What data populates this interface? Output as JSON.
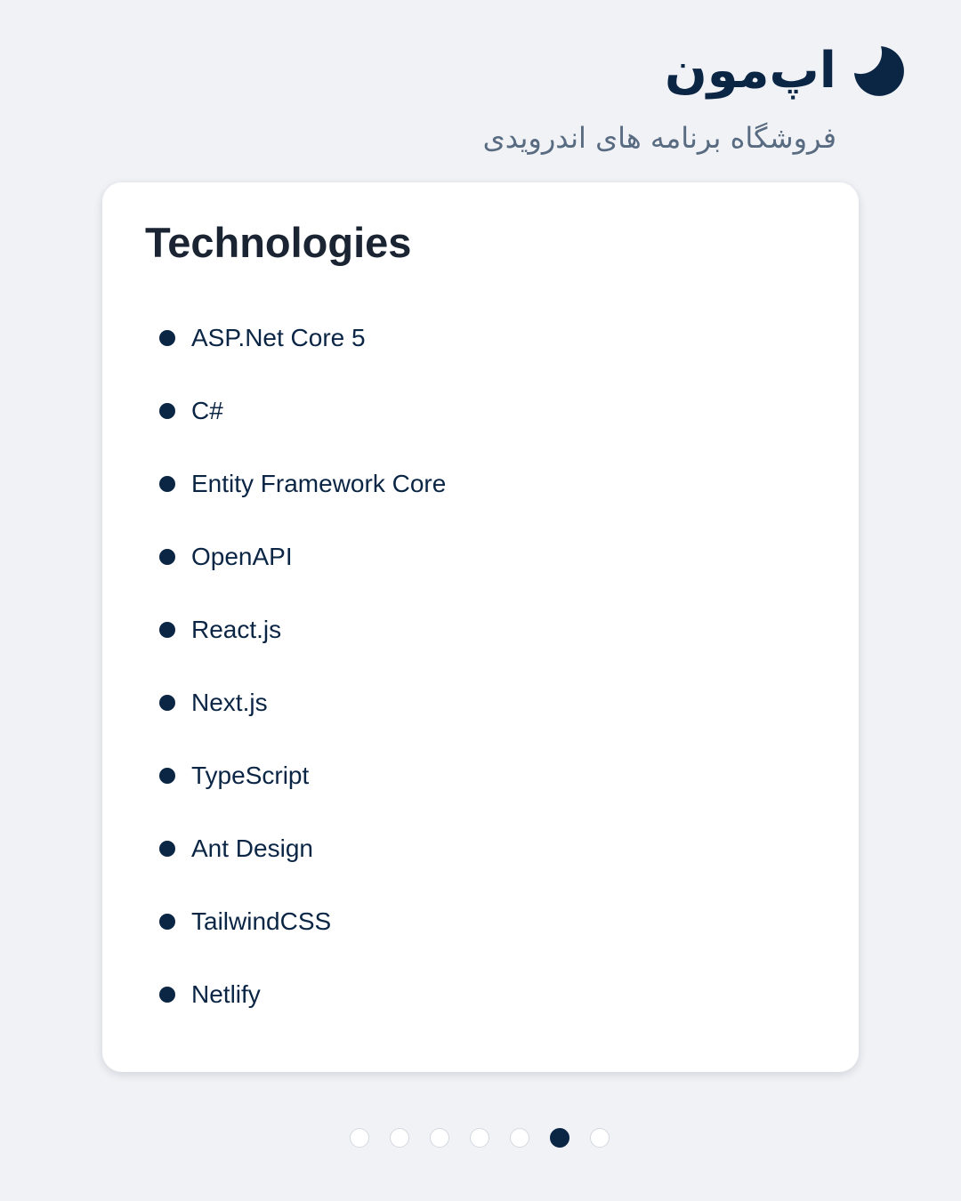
{
  "brand": {
    "name": "اپ‌مون",
    "tagline": "فروشگاه برنامه های اندرویدی",
    "icon": "moon-icon",
    "color": "#0b2545"
  },
  "card": {
    "title": "Technologies",
    "items": [
      "ASP.Net Core 5",
      "C#",
      "Entity Framework Core",
      "OpenAPI",
      "React.js",
      "Next.js",
      "TypeScript",
      "Ant Design",
      "TailwindCSS",
      "Netlify"
    ]
  },
  "pagination": {
    "total": 7,
    "current": 6
  },
  "colors": {
    "background": "#f0f2f6",
    "card": "#ffffff",
    "accent": "#0b2545",
    "tagline": "#586b80"
  }
}
